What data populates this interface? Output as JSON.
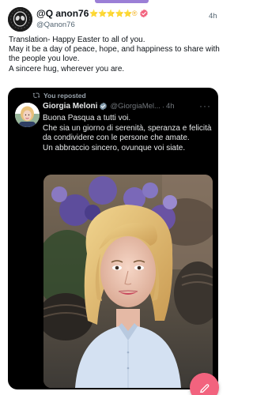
{
  "outer_tweet": {
    "author_name": "@Q anon76",
    "author_badges": "⭐⭐⭐⭐⭐®",
    "handle": "@Qanon76",
    "time": "4h",
    "text_lines": [
      "Translation- Happy Easter to all of you.",
      "May it be a day of peace, hope, and happiness to share with the people you love.",
      "A sincere hug, wherever you are."
    ]
  },
  "repost": {
    "label": "You reposted"
  },
  "quoted_tweet": {
    "author_name": "Giorgia Meloni",
    "handle": "@GiorgiaMel...",
    "dot": "·",
    "time": "4h",
    "more": "···",
    "text_lines": [
      "Buona Pasqua a tutti voi.",
      "Che sia un giorno di serenità, speranza e felicità da condividere con le persone che amate.",
      "Un abbraccio sincero, ovunque voi siate."
    ]
  },
  "icons": {
    "avatar_outer": "alien-avatar-icon",
    "verified_outer": "verified-badge-icon",
    "verified_quoted": "verified-badge-icon",
    "repost": "repost-icon",
    "compose": "compose-icon"
  },
  "colors": {
    "accent_pink": "#f2637e",
    "quoted_bg": "#000000",
    "text_dark": "#0f1419",
    "text_muted": "#536471",
    "star": "#f2b01e",
    "indicator": "#9b7fd6"
  }
}
